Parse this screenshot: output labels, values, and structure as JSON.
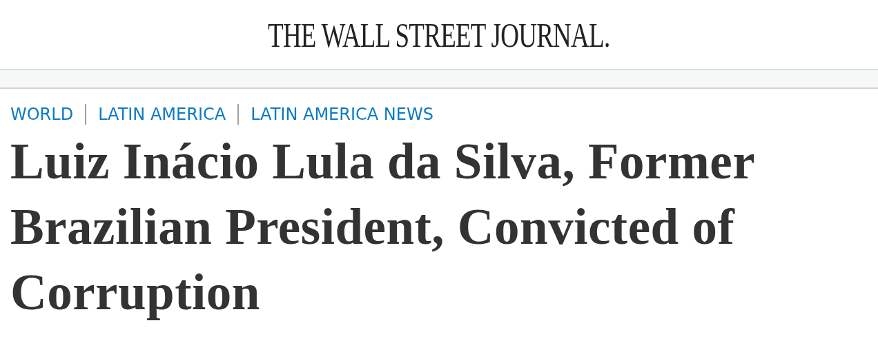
{
  "masthead": {
    "logo": "THE WALL STREET JOURNAL."
  },
  "breadcrumbs": [
    {
      "label": "WORLD"
    },
    {
      "label": "LATIN AMERICA"
    },
    {
      "label": "LATIN AMERICA NEWS"
    }
  ],
  "headline": "Luiz Inácio Lula da Silva, Former Brazilian President, Convicted of Corruption"
}
